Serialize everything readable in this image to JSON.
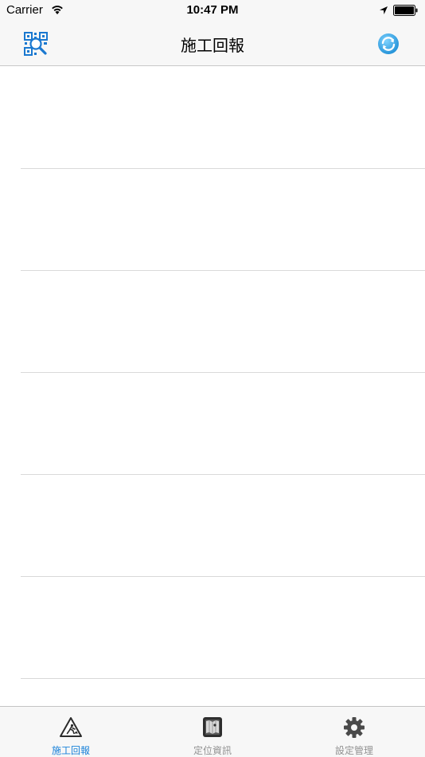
{
  "status_bar": {
    "carrier": "Carrier",
    "time": "10:47 PM"
  },
  "nav_bar": {
    "title": "施工回報",
    "left_icon": "qr-scan-icon",
    "right_icon": "refresh-icon"
  },
  "list": {
    "rows": [
      "",
      "",
      "",
      "",
      "",
      ""
    ]
  },
  "tab_bar": {
    "tabs": [
      {
        "label": "施工回報",
        "icon": "construction-sign-icon",
        "active": true
      },
      {
        "label": "定位資訊",
        "icon": "map-book-icon",
        "active": false
      },
      {
        "label": "設定管理",
        "icon": "gear-icon",
        "active": false
      }
    ]
  },
  "colors": {
    "accent": "#1a82d9",
    "inactive": "#929292",
    "bar_background": "#f7f7f7"
  }
}
